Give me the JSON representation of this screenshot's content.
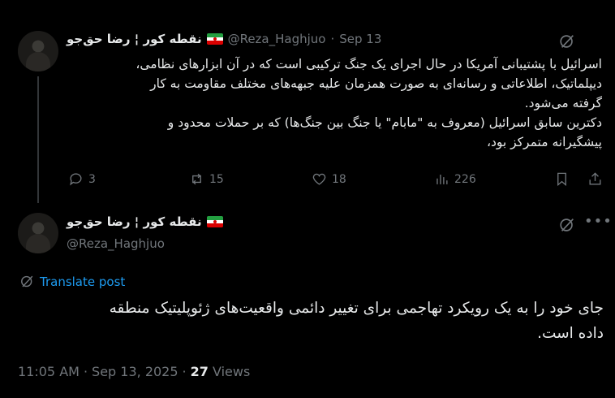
{
  "tweet1": {
    "display_name": "نقطه کور ¦ رضا حق‌جو",
    "handle": "@Reza_Haghjuo",
    "separator": "·",
    "date": "Sep 13",
    "body_lines": [
      "اسرائیل با پشتیبانی آمریکا در حال اجرای یک جنگ ترکیبی است که در آن ابزارهای نظامی،",
      "دیپلماتیک، اطلاعاتی و رسانه‌ای به صورت همزمان علیه جبهه‌های مختلف مقاومت به کار",
      "گرفته می‌شود.",
      "دکترین سابق اسرائیل (معروف به \"مابام\" یا جنگ بین جنگ‌ها) که بر حملات محدود و",
      "پیشگیرانه متمرکز بود،"
    ],
    "replies": "3",
    "reposts": "15",
    "likes": "18",
    "views": "226"
  },
  "tweet2": {
    "display_name": "نقطه کور ¦ رضا حق‌جو",
    "handle": "@Reza_Haghjuo",
    "translate_label": "Translate post",
    "body_lines": [
      "جای خود را به یک رویکرد تهاجمی برای تغییر دائمی واقعیت‌های ژئوپلیتیک منطقه",
      "داده است."
    ],
    "time": "11:05 AM",
    "dot": "·",
    "full_date": "Sep 13, 2025",
    "dot2": "·",
    "views_count": "27",
    "views_label": "Views"
  },
  "icons": {
    "grok": "grok-icon",
    "more": "more-icon",
    "reply": "reply-icon",
    "repost": "repost-icon",
    "like": "heart-icon",
    "views": "analytics-icon",
    "bookmark": "bookmark-icon",
    "share": "share-icon",
    "translate": "translate-icon"
  },
  "colors": {
    "background": "#000000",
    "text": "#e7e9ea",
    "muted": "#71767b",
    "link": "#1d9bf0"
  }
}
